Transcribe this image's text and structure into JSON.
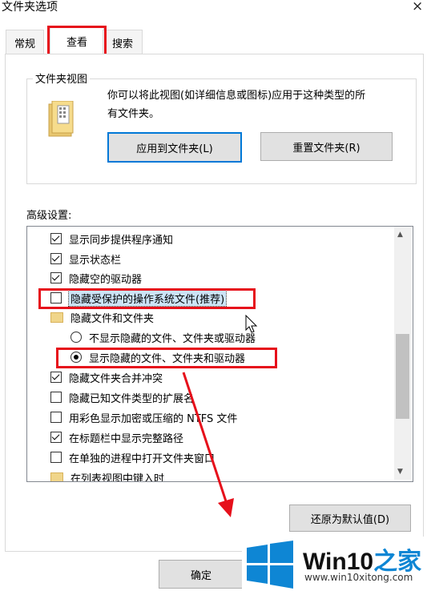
{
  "window": {
    "title": "文件夹选项",
    "close": "×"
  },
  "tabs": [
    {
      "label": "常规"
    },
    {
      "label": "查看"
    },
    {
      "label": "搜索"
    }
  ],
  "folder_views": {
    "group_label": "文件夹视图",
    "description_line1": "你可以将此视图(如详细信息或图标)应用于这种类型的所",
    "description_line2": "有文件夹。",
    "apply_button": "应用到文件夹(L)",
    "reset_button": "重置文件夹(R)"
  },
  "advanced": {
    "label": "高级设置:",
    "items": [
      {
        "type": "checkbox",
        "checked": true,
        "label": "显示同步提供程序通知"
      },
      {
        "type": "checkbox",
        "checked": true,
        "label": "显示状态栏"
      },
      {
        "type": "checkbox",
        "checked": true,
        "label": "隐藏空的驱动器"
      },
      {
        "type": "checkbox",
        "checked": false,
        "label": "隐藏受保护的操作系统文件(推荐)"
      },
      {
        "type": "folder",
        "label": "隐藏文件和文件夹"
      },
      {
        "type": "radio",
        "checked": false,
        "label": "不显示隐藏的文件、文件夹或驱动器"
      },
      {
        "type": "radio",
        "checked": true,
        "label": "显示隐藏的文件、文件夹和驱动器"
      },
      {
        "type": "checkbox",
        "checked": true,
        "label": "隐藏文件夹合并冲突"
      },
      {
        "type": "checkbox",
        "checked": false,
        "label": "隐藏已知文件类型的扩展名"
      },
      {
        "type": "checkbox",
        "checked": false,
        "label": "用彩色显示加密或压缩的 NTFS 文件"
      },
      {
        "type": "checkbox",
        "checked": true,
        "label": "在标题栏中显示完整路径"
      },
      {
        "type": "checkbox",
        "checked": false,
        "label": "在单独的进程中打开文件夹窗口"
      },
      {
        "type": "folder",
        "label": "在列表视图中键入时"
      }
    ],
    "restore_button": "还原为默认值(D)"
  },
  "footer": {
    "ok_button": "确定"
  },
  "watermark": {
    "brand_a": "Win10",
    "brand_b": "之家",
    "url": "www.win10xitong.com"
  },
  "colors": {
    "highlight_red": "#e6101b",
    "accent_blue": "#0078d7",
    "selection": "#cce4f7"
  }
}
